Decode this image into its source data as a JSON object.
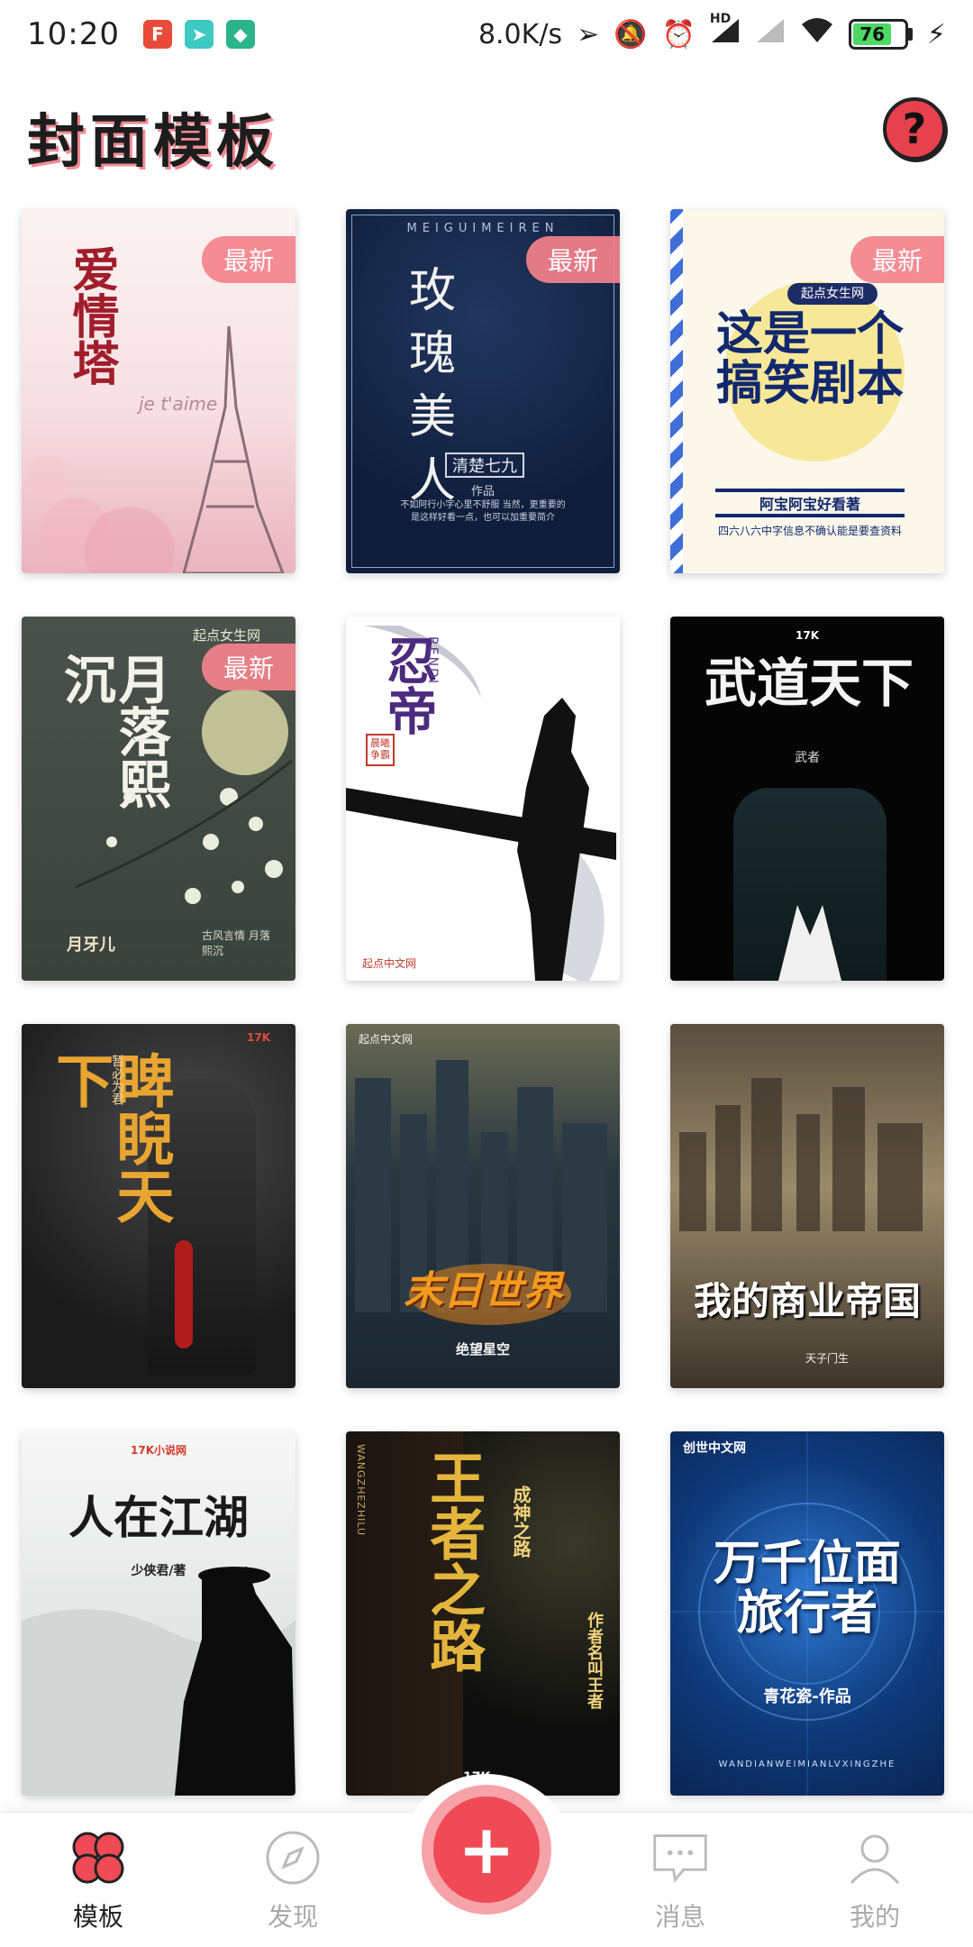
{
  "status_bar": {
    "time": "10:20",
    "net_speed": "8.0K/s",
    "signal_label": "HD",
    "battery": "76",
    "battery_level": 0.76
  },
  "header": {
    "title": "封面模板",
    "help_label": "?"
  },
  "templates": [
    {
      "title": "爱情塔",
      "subtitle": "je t'aime",
      "badge": "最新"
    },
    {
      "title": "玫瑰美人",
      "top_text": "MEIGUIMEIREN",
      "author": "清楚七九",
      "author_suffix": "作品",
      "blurb": "不如阿行小字心里不舒服 当然，更重要的是这样好看一点，也可以加重要简介",
      "badge": "最新"
    },
    {
      "brand": "起点女生网",
      "title": "这是一个搞笑剧本",
      "author_line": "阿宝阿宝好看著",
      "blurb": "四六八六中字信息不确认能是要查资料",
      "badge": "最新"
    },
    {
      "brand": "起点女生网",
      "title": "月落熙沉",
      "author": "月牙儿",
      "sub": "古风言情 月落熙沉",
      "badge": "最新"
    },
    {
      "title": "忍帝",
      "roman": "RENDI",
      "seal": "晨曦争霸",
      "brand": "起点中文网"
    },
    {
      "brand": "17K",
      "title": "武道天下",
      "author": "武者"
    },
    {
      "brand": "17K",
      "title": "睥睨天下",
      "author": "暂必为君"
    },
    {
      "brand": "起点中文网",
      "title": "末日世界",
      "author": "绝望星空"
    },
    {
      "title": "我的商业帝国",
      "author": "天子门生"
    },
    {
      "brand": "17K小说网",
      "title": "人在江湖",
      "author": "少侠君/著"
    },
    {
      "roman": "WANGZHEZHILU",
      "title": "王者之路",
      "subtitle": "成神之路",
      "author": "作者名叫王者",
      "brand": "17K"
    },
    {
      "brand": "创世中文网",
      "title": "万千位面旅行者",
      "author": "青花瓷-作品",
      "roman": "WANDIANWEIMIANLVXINGZHE"
    }
  ],
  "bottom_nav": {
    "items": [
      {
        "label": "模板"
      },
      {
        "label": "发现"
      },
      {
        "label": "消息"
      },
      {
        "label": "我的"
      }
    ],
    "fab_label": "+"
  },
  "colors": {
    "accent": "#ef4a56",
    "badge": "#f4828c"
  }
}
